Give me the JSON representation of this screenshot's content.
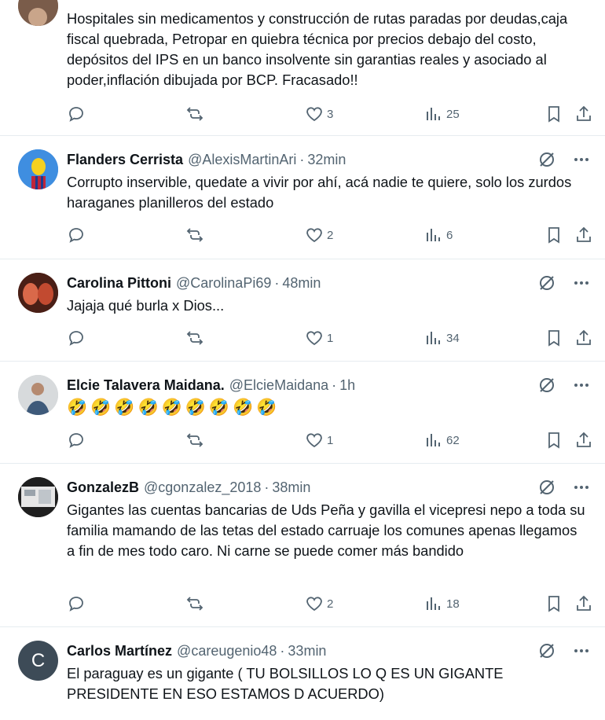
{
  "replies": [
    {
      "text": "Hospitales sin medicamentos y construcción de rutas paradas por deudas,caja fiscal quebrada, Petropar en quiebra técnica por precios debajo del costo, depósitos  del IPS en un banco insolvente sin garantias reales y asociado al poder,inflación dibujada por BCP. Fracasado!!",
      "likes": "3",
      "views": "25"
    },
    {
      "name": "Flanders Cerrista",
      "handle": "@AlexisMartinAri",
      "time": "32min",
      "text": "Corrupto inservible, quedate a vivir por ahí, acá nadie te quiere, solo los zurdos haraganes planilleros del estado",
      "likes": "2",
      "views": "6"
    },
    {
      "name": "Carolina Pittoni",
      "handle": "@CarolinaPi69",
      "time": "48min",
      "text": "Jajaja qué burla x Dios...",
      "likes": "1",
      "views": "34"
    },
    {
      "name": "Elcie Talavera Maidana.",
      "handle": "@ElcieMaidana",
      "time": "1h",
      "text": "🤣🤣🤣🤣🤣🤣🤣🤣🤣",
      "likes": "1",
      "views": "62"
    },
    {
      "name": "GonzalezB",
      "handle": "@cgonzalez_2018",
      "time": "38min",
      "text": "Gigantes las cuentas bancarias de Uds Peña y gavilla el vicepresi nepo a toda su familia mamando de las tetas del estado carruaje los comunes apenas llegamos a fin de mes todo caro. Ni carne se puede comer más bandido",
      "likes": "2",
      "views": "18"
    },
    {
      "name": "Carlos Martínez",
      "handle": "@careugenio48",
      "time": "33min",
      "avatar_letter": "C",
      "text": "El paraguay es un gigante ( TU BOLSILLOS LO Q ES UN GIGANTE PRESIDENTE EN ESO ESTAMOS D ACUERDO)"
    }
  ],
  "icons": {
    "reply": "reply-icon",
    "retweet": "retweet-icon",
    "like": "heart-icon",
    "views": "views-icon",
    "bookmark": "bookmark-icon",
    "share": "share-icon",
    "grok": "grok-icon",
    "more": "more-icon"
  },
  "colors": {
    "text": "#0f1419",
    "secondary": "#536471",
    "divider": "#e6ecf0"
  }
}
